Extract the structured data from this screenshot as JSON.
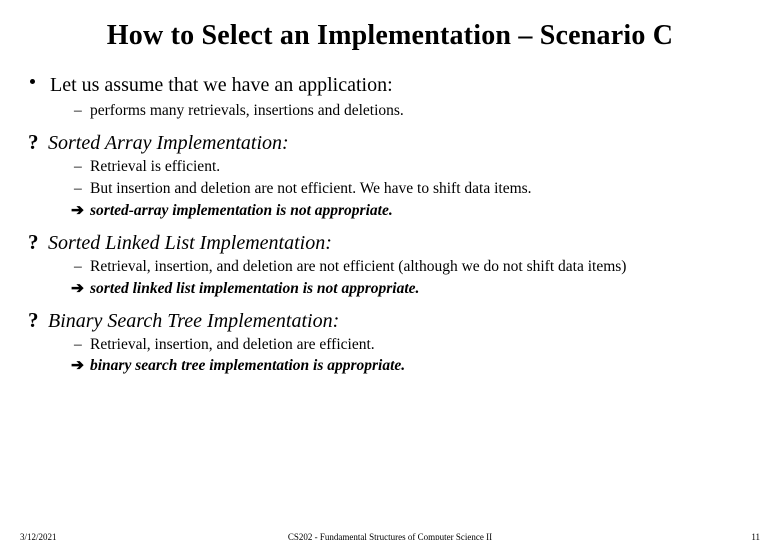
{
  "title": "How to Select an Implementation – Scenario C",
  "assume": {
    "line": "Let us assume that we have an application:",
    "sub": "performs many retrievals, insertions and deletions."
  },
  "sections": [
    {
      "q": "?",
      "heading": "Sorted Array Implementation:",
      "items": [
        {
          "kind": "dash",
          "text": "Retrieval is efficient."
        },
        {
          "kind": "dash",
          "text": "But insertion and deletion are not efficient. We have to shift data items."
        },
        {
          "kind": "arrow",
          "text": "sorted-array implementation is not appropriate.",
          "emph": true
        }
      ]
    },
    {
      "q": "?",
      "heading": "Sorted Linked List Implementation:",
      "items": [
        {
          "kind": "dash",
          "text": "Retrieval, insertion, and deletion are not efficient (although we do not shift data items)"
        },
        {
          "kind": "arrow",
          "text": "sorted linked list implementation is not appropriate.",
          "emph": true
        }
      ]
    },
    {
      "q": "?",
      "heading": "Binary Search Tree Implementation:",
      "items": [
        {
          "kind": "dash",
          "text": "Retrieval, insertion, and deletion are efficient."
        },
        {
          "kind": "arrow",
          "text": "binary search tree implementation is appropriate.",
          "emph": true
        }
      ]
    }
  ],
  "footer": {
    "date": "3/12/2021",
    "course": "CS202 - Fundamental Structures of Computer Science II",
    "page": "11"
  },
  "glyphs": {
    "dash": "–",
    "arrow": "➔"
  }
}
